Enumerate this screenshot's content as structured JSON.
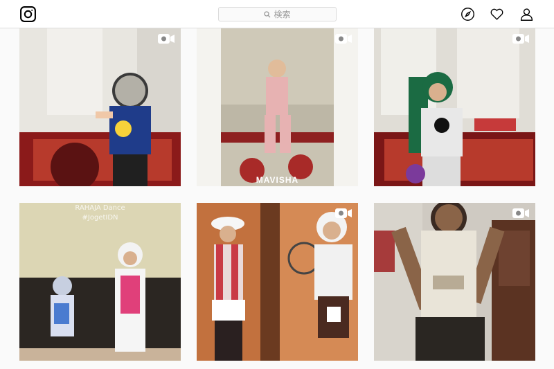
{
  "header": {
    "logo_icon": "instagram-logo-icon",
    "search_placeholder": "検索",
    "nav_icons": [
      "compass-explore-icon",
      "heart-activity-icon",
      "person-profile-icon"
    ]
  },
  "grid": {
    "tiles": [
      {
        "type": "video",
        "overlay_text": ""
      },
      {
        "type": "video",
        "overlay_text": "MAVISHA"
      },
      {
        "type": "video",
        "overlay_text": ""
      },
      {
        "type": "image",
        "overlay_line1": "RAHAJA Dance",
        "overlay_line2": "#JogetIDN"
      },
      {
        "type": "video",
        "overlay_text": ""
      },
      {
        "type": "video",
        "overlay_text": ""
      }
    ]
  }
}
